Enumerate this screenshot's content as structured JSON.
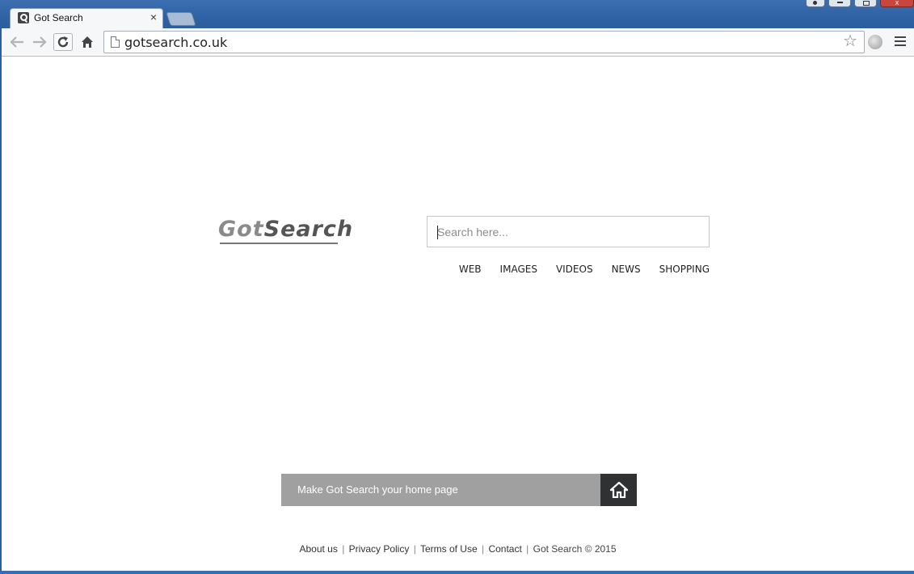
{
  "browser": {
    "tab_title": "Got Search",
    "tab_close": "×",
    "url": "gotsearch.co.uk",
    "close_glyph": "x"
  },
  "page": {
    "logo": {
      "part1": "Got",
      "part2": "Search"
    },
    "search": {
      "placeholder": "Search here..."
    },
    "categories": [
      "WEB",
      "IMAGES",
      "VIDEOS",
      "NEWS",
      "SHOPPING"
    ],
    "homepage_bar": {
      "label": "Make Got Search your home page"
    },
    "footer": {
      "links": [
        "About us",
        "Privacy Policy",
        "Terms of Use",
        "Contact"
      ],
      "copyright": "Got Search © 2015",
      "separator": "|"
    }
  },
  "icons": {
    "favicon": "magnifier-icon",
    "back": "back-arrow-icon",
    "forward": "forward-arrow-icon",
    "reload": "reload-icon",
    "home": "home-icon",
    "bookmark": "star-icon",
    "menu": "hamburger-menu-icon"
  }
}
